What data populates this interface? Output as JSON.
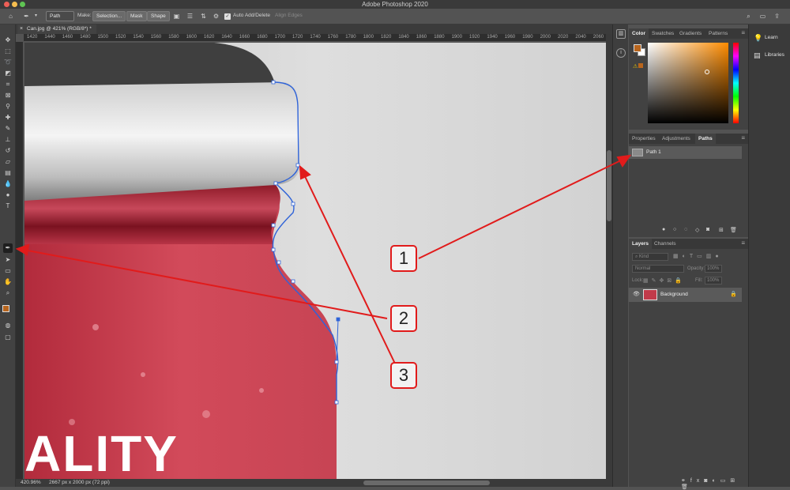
{
  "app": {
    "window_title": "Adobe Photoshop 2020",
    "document_tab": "Can.jpg @ 421% (RGB/8*) *"
  },
  "options_bar": {
    "tool_mode": "Path",
    "make_label": "Make:",
    "selection_button": "Selection...",
    "mask_button": "Mask",
    "shape_button": "Shape",
    "auto_add_delete": "Auto Add/Delete",
    "align_edges": "Align Edges"
  },
  "ruler": {
    "ticks": [
      "1420",
      "1440",
      "1460",
      "1480",
      "1500",
      "1520",
      "1540",
      "1560",
      "1580",
      "1600",
      "1620",
      "1640",
      "1660",
      "1680",
      "1700",
      "1720",
      "1740",
      "1760",
      "1780",
      "1800",
      "1820",
      "1840",
      "1860",
      "1880",
      "1900",
      "1920",
      "1940",
      "1960",
      "1980",
      "2000",
      "2020",
      "2040",
      "2060"
    ]
  },
  "canvas": {
    "label_text": "ALITY"
  },
  "status": {
    "zoom": "420.96%",
    "doc_size": "2667 px x 2000 px (72 ppi)"
  },
  "color_panel": {
    "tabs": [
      "Color",
      "Swatches",
      "Gradients",
      "Patterns"
    ],
    "foreground": "#b8651d",
    "background": "#ffffff"
  },
  "paths_panel": {
    "tabs": [
      "Properties",
      "Adjustments",
      "Paths"
    ],
    "items": [
      {
        "name": "Path 1"
      }
    ]
  },
  "layers_panel": {
    "tabs": [
      "Layers",
      "Channels"
    ],
    "kind_placeholder": "Kind",
    "blend_mode": "Normal",
    "opacity_label": "Opacity:",
    "opacity_value": "100%",
    "lock_label": "Lock:",
    "fill_label": "Fill:",
    "fill_value": "100%",
    "layers": [
      {
        "name": "Background"
      }
    ]
  },
  "learn_panel": {
    "learn": "Learn",
    "libraries": "Libraries"
  },
  "callouts": [
    "1",
    "2",
    "3"
  ],
  "colors": {
    "accent_red": "#e11b1b",
    "path_blue": "#2f63d8"
  }
}
